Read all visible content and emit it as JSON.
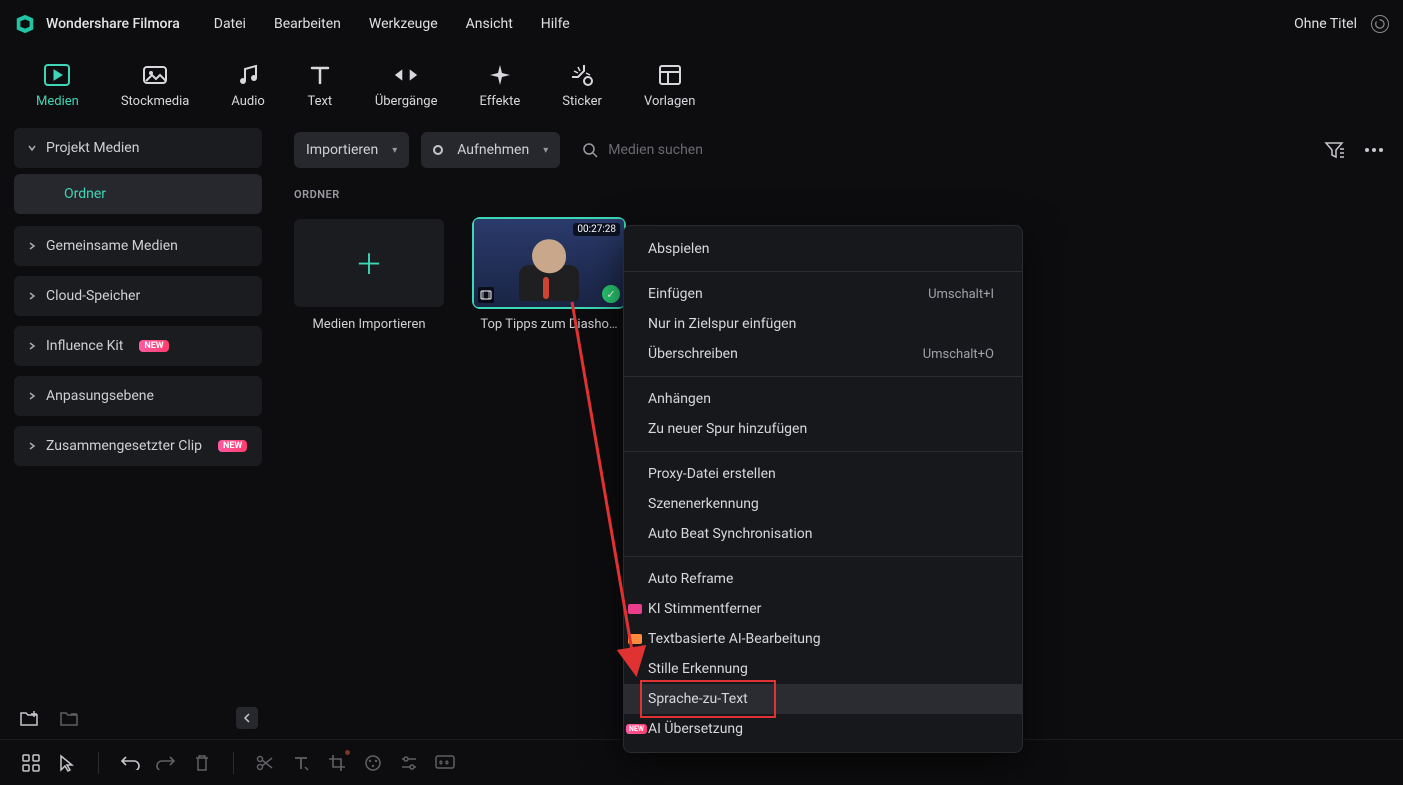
{
  "titlebar": {
    "app_name": "Wondershare Filmora",
    "menu": [
      "Datei",
      "Bearbeiten",
      "Werkzeuge",
      "Ansicht",
      "Hilfe"
    ],
    "project_title": "Ohne Titel"
  },
  "tabs": [
    {
      "label": "Medien",
      "active": true
    },
    {
      "label": "Stockmedia"
    },
    {
      "label": "Audio"
    },
    {
      "label": "Text"
    },
    {
      "label": "Übergänge"
    },
    {
      "label": "Effekte"
    },
    {
      "label": "Sticker"
    },
    {
      "label": "Vorlagen"
    }
  ],
  "sidebar": {
    "items": [
      {
        "label": "Projekt Medien",
        "expanded": true,
        "sub": [
          {
            "label": "Ordner",
            "active": true
          }
        ]
      },
      {
        "label": "Gemeinsame Medien"
      },
      {
        "label": "Cloud-Speicher"
      },
      {
        "label": "Influence Kit",
        "badge": "NEW"
      },
      {
        "label": "Anpasungsebene"
      },
      {
        "label": "Zusammengesetzter Clip",
        "badge": "NEW"
      }
    ]
  },
  "content": {
    "import_label": "Importieren",
    "record_label": "Aufnehmen",
    "search_placeholder": "Medien suchen",
    "section_label": "ORDNER",
    "import_card": "Medien Importieren",
    "clip": {
      "caption": "Top Tipps zum Diasho…",
      "duration": "00:27:28"
    }
  },
  "context_menu": {
    "groups": [
      [
        {
          "label": "Abspielen"
        }
      ],
      [
        {
          "label": "Einfügen",
          "shortcut": "Umschalt+I"
        },
        {
          "label": "Nur in Zielspur einfügen"
        },
        {
          "label": "Überschreiben",
          "shortcut": "Umschalt+O"
        }
      ],
      [
        {
          "label": "Anhängen"
        },
        {
          "label": "Zu neuer Spur hinzufügen"
        }
      ],
      [
        {
          "label": "Proxy-Datei erstellen"
        },
        {
          "label": "Szenenerkennung"
        },
        {
          "label": "Auto Beat Synchronisation"
        }
      ],
      [
        {
          "label": "Auto Reframe"
        },
        {
          "label": "KI Stimmentferner",
          "badge": "pink"
        },
        {
          "label": "Textbasierte AI-Bearbeitung",
          "badge": "orange"
        },
        {
          "label": "Stille Erkennung"
        },
        {
          "label": "Sprache-zu-Text",
          "highlight": true,
          "redbox": true
        },
        {
          "label": "AI Übersetzung",
          "new_left": true
        }
      ]
    ]
  }
}
